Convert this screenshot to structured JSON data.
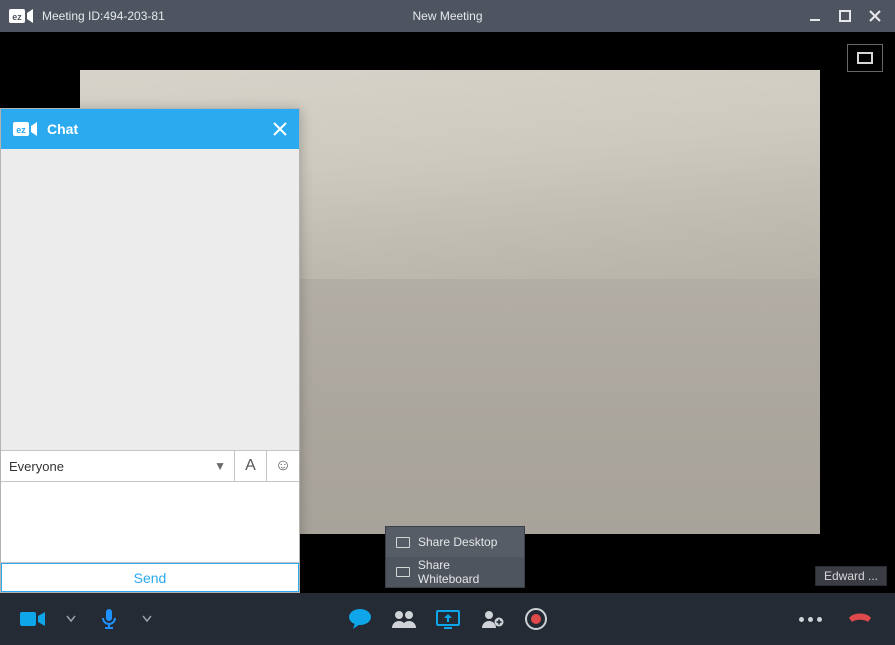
{
  "titlebar": {
    "meeting_id_label": "Meeting ID:494-203-81",
    "window_title": "New Meeting"
  },
  "icons": {
    "app": "ez-camera-icon",
    "minimize": "minimize-icon",
    "maximize": "maximize-icon",
    "close": "close-icon",
    "fullscreen": "fullscreen-icon"
  },
  "share_menu": {
    "items": [
      {
        "label": "Share Desktop",
        "icon": "desktop-icon"
      },
      {
        "label": "Share Whiteboard",
        "icon": "whiteboard-icon"
      }
    ]
  },
  "participant_label": "Edward ...",
  "chat": {
    "title": "Chat",
    "recipient": "Everyone",
    "font_button": "A",
    "emoji_button": "☺",
    "send_label": "Send",
    "input_placeholder": ""
  },
  "toolbar": {
    "camera": "camera-icon",
    "mic": "mic-icon",
    "mic_caret": "chevron-down-icon",
    "chat": "chat-icon",
    "participants": "participants-icon",
    "share": "share-screen-icon",
    "invite": "add-user-icon",
    "record": "record-icon",
    "more": "more-icon",
    "hangup": "hangup-icon"
  },
  "colors": {
    "accent_blue": "#2baaef",
    "danger_red": "#e0494b",
    "titlebar_bg": "#4f5560",
    "toolbar_bg": "#242b35"
  }
}
